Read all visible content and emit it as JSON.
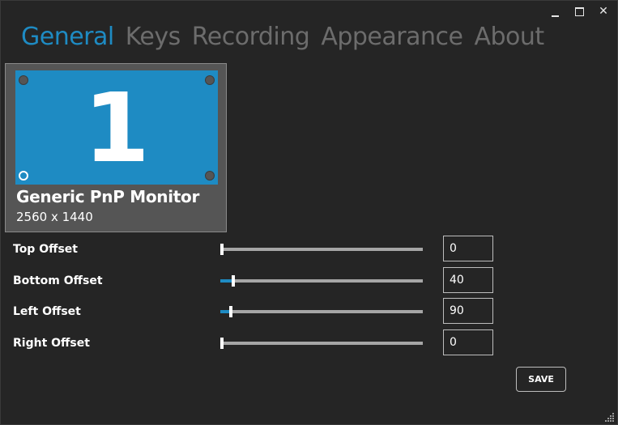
{
  "window": {
    "controls": {
      "minimize": "minimize-icon",
      "maximize": "maximize-icon",
      "close": "close-icon"
    }
  },
  "tabs": [
    {
      "label": "General",
      "active": true
    },
    {
      "label": "Keys",
      "active": false
    },
    {
      "label": "Recording",
      "active": false
    },
    {
      "label": "Appearance",
      "active": false
    },
    {
      "label": "About",
      "active": false
    }
  ],
  "monitor": {
    "number": "1",
    "name": "Generic PnP Monitor",
    "resolution": "2560 x 1440",
    "selected_corner": "bottom-left"
  },
  "offsets": [
    {
      "label": "Top Offset",
      "value": "0",
      "slider_fraction": 0.0
    },
    {
      "label": "Bottom Offset",
      "value": "40",
      "slider_fraction": 0.055
    },
    {
      "label": "Left Offset",
      "value": "90",
      "slider_fraction": 0.045
    },
    {
      "label": "Right Offset",
      "value": "0",
      "slider_fraction": 0.0
    }
  ],
  "actions": {
    "save_label": "SAVE"
  },
  "colors": {
    "accent": "#1e8bc3",
    "background": "#252525",
    "card": "#555555",
    "inactive_tab": "#6c6c6c"
  }
}
